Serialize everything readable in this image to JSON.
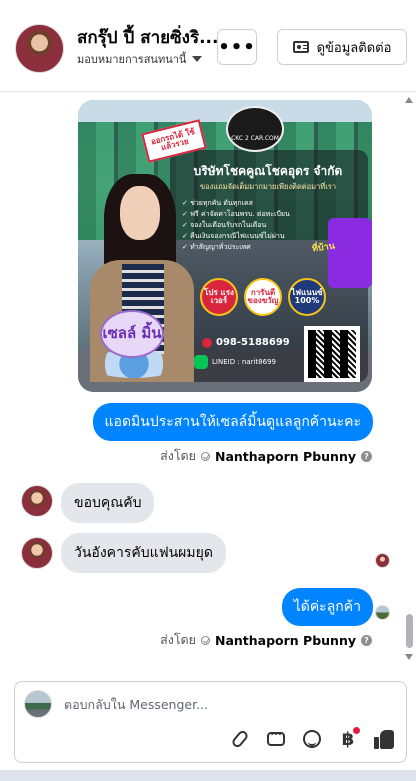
{
  "header": {
    "name": "สกรุ๊ป ปี้ สายซิ่งริ...",
    "assign_label": "มอบหมายการสนทนานี้",
    "more_label": "•••",
    "contact_label": "ดูข้อมูลติดต่อ"
  },
  "ad": {
    "logo_text": "CKC 2 CAR.COM",
    "badge_top": "ออกรถได้ ใช้แล้วรวย",
    "company": "บริษัทโชคคูณโชคอุดร จำกัด",
    "tagline": "ของแถมจัดเต็มมากมายเพียงติดต่อมาที่เรา",
    "bullets": [
      "✓ ช่วยทุกคัน ดันทุกเคส",
      "✓ ฟรี ค่าจัดค่าโอนพรบ. ต่อทะเบียน",
      "✓ จองในเดือนรับรถในเดือน",
      "✓ คืนเงินจองกรณีไฟแนนซ์ไม่ผ่าน",
      "✓ ทำสัญญาทั่วประเทศ"
    ],
    "purple_text": "ที่บ้าน",
    "circles": [
      "โปร แรง เวอร์",
      "การันตี ของขวัญ",
      "ไฟแนนซ์ 100%"
    ],
    "phone": "098-5188699",
    "line_id": "LINEID : narit8699",
    "name_badge": "เซลล์ มิ้น"
  },
  "messages": {
    "out1": "แอดมินประสานให้เซลล์มิ้นดูแลลูกค้านะคะ",
    "sentby_label": "ส่งโดย",
    "sender": "Nanthaporn Pbunny",
    "info": "?",
    "in1": "ขอบคุณคับ",
    "in2": "วันอังคารคับแฟนผมยุด",
    "out2": "ได้ค่ะลูกค้า"
  },
  "composer": {
    "placeholder": "ตอบกลับใน Messenger..."
  },
  "icons": {
    "attach": "paperclip-icon",
    "saved_replies": "chat-bubble-icon",
    "emoji": "smile-icon",
    "payment": "baht-icon",
    "like": "thumbs-up-icon"
  },
  "colors": {
    "accent": "#0084ff",
    "incoming_bubble": "#e4e6eb",
    "notification": "#e41e3f"
  }
}
